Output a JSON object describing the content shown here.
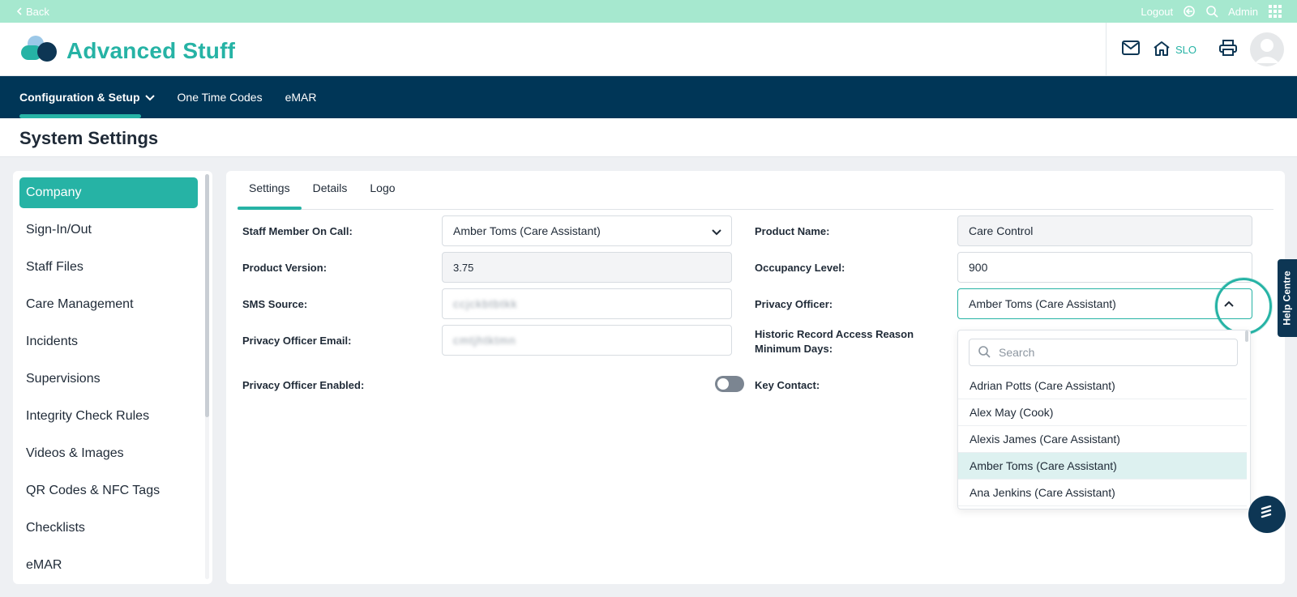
{
  "topbar": {
    "back_label": "Back",
    "logout_label": "Logout",
    "user_label": "Admin",
    "icons": [
      "chevron-left-icon",
      "logout-icon",
      "search-icon",
      "apps-grid-icon"
    ]
  },
  "header": {
    "app_name": "Advanced Stuff",
    "home_label": "SLO",
    "icons": [
      "mail-icon",
      "home-icon",
      "printer-icon",
      "avatar"
    ]
  },
  "nav": {
    "items": [
      {
        "label": "Configuration & Setup",
        "active": true,
        "has_dropdown": true
      },
      {
        "label": "One Time Codes",
        "active": false
      },
      {
        "label": "eMAR",
        "active": false
      }
    ]
  },
  "page": {
    "title": "System Settings"
  },
  "sidebar": {
    "items": [
      {
        "label": "Company",
        "active": true
      },
      {
        "label": "Sign-In/Out"
      },
      {
        "label": "Staff Files"
      },
      {
        "label": "Care Management"
      },
      {
        "label": "Incidents"
      },
      {
        "label": "Supervisions"
      },
      {
        "label": "Integrity Check Rules"
      },
      {
        "label": "Videos & Images"
      },
      {
        "label": "QR Codes & NFC Tags"
      },
      {
        "label": "Checklists"
      },
      {
        "label": "eMAR"
      }
    ]
  },
  "tabs": [
    {
      "label": "Settings",
      "active": true
    },
    {
      "label": "Details"
    },
    {
      "label": "Logo"
    }
  ],
  "form": {
    "staff_on_call": {
      "label": "Staff Member On Call:",
      "value": "Amber Toms (Care Assistant)"
    },
    "product_version": {
      "label": "Product Version:",
      "value": "3.75"
    },
    "sms_source": {
      "label": "SMS Source:",
      "value": "ccjckbtbtkk"
    },
    "privacy_officer_email": {
      "label": "Privacy Officer Email:",
      "value": "cmtjhtktmn"
    },
    "privacy_officer_enabled": {
      "label": "Privacy Officer Enabled:",
      "enabled": false
    },
    "product_name": {
      "label": "Product Name:",
      "value": "Care Control"
    },
    "occupancy_level": {
      "label": "Occupancy Level:",
      "value": "900"
    },
    "privacy_officer": {
      "label": "Privacy Officer:",
      "value": "Amber Toms (Care Assistant)"
    },
    "historic_record_days": {
      "label": "Historic Record Access Reason Minimum Days:"
    },
    "key_contact": {
      "label": "Key Contact:"
    }
  },
  "dropdown": {
    "search_placeholder": "Search",
    "options": [
      {
        "label": "Adrian Potts (Care Assistant)"
      },
      {
        "label": "Alex May (Cook)"
      },
      {
        "label": "Alexis James (Care Assistant)"
      },
      {
        "label": "Amber Toms (Care Assistant)",
        "selected": true
      },
      {
        "label": "Ana Jenkins (Care Assistant)"
      }
    ]
  },
  "help": {
    "label": "Help Centre"
  },
  "colors": {
    "accent": "#26b3a5",
    "nav_bg": "#003657",
    "top_strip": "#a6e8cf",
    "help_bg": "#0d3654"
  }
}
